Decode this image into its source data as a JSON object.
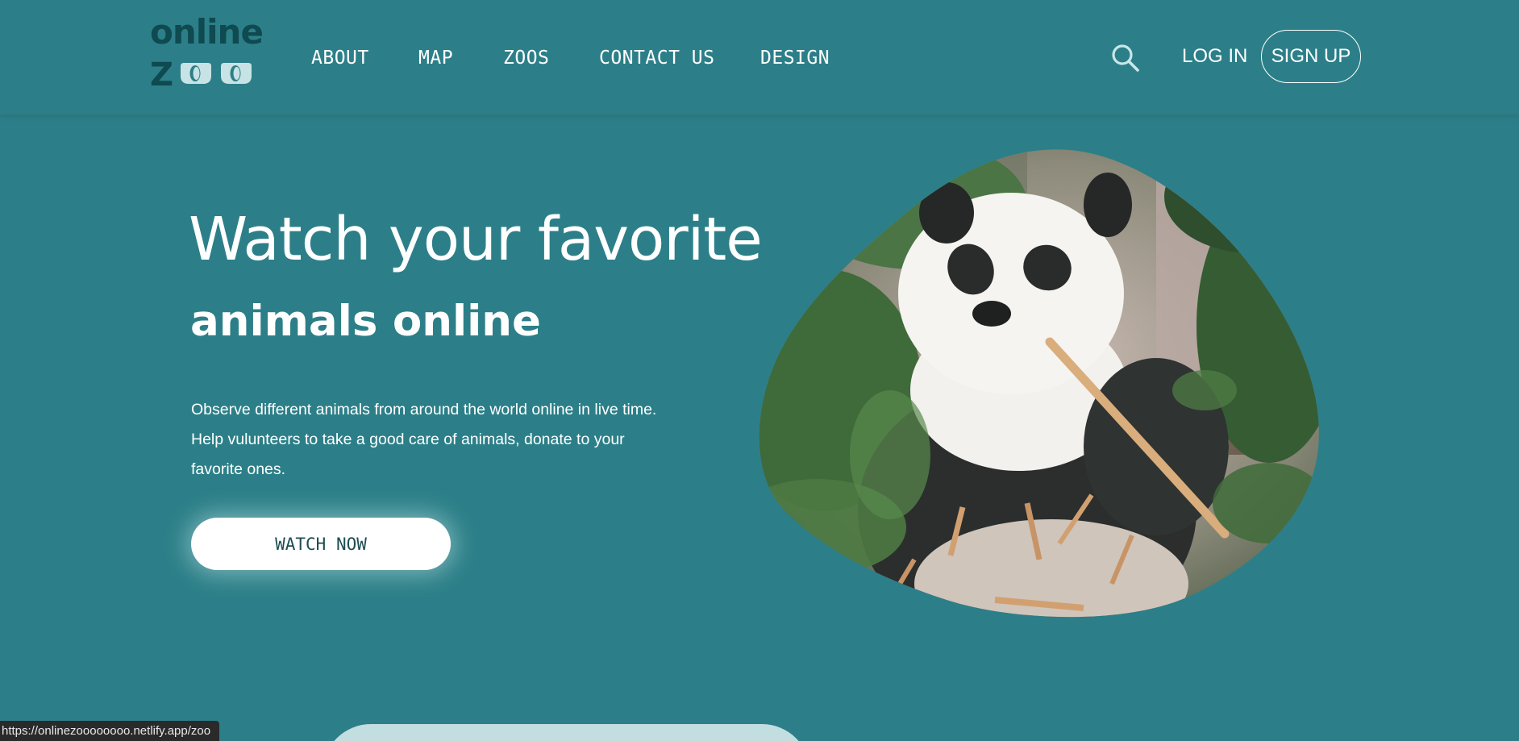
{
  "logo": {
    "line1": "online",
    "line2_letter": "Z",
    "accent_color": "#c7e3e5",
    "ink_color": "#0f4a50"
  },
  "nav": {
    "items": [
      {
        "label": "ABOUT"
      },
      {
        "label": "MAP"
      },
      {
        "label": "ZOOS"
      },
      {
        "label": "CONTACT US"
      },
      {
        "label": "DESIGN"
      }
    ]
  },
  "header_actions": {
    "search_icon": "search-icon",
    "login_label": "LOG IN",
    "signup_label": "SIGN UP"
  },
  "hero": {
    "title_line1": "Watch your favorite",
    "title_line2": "animals online",
    "description_lines": [
      "Observe different animals from around the world online in live time.",
      "Help vulunteers to take a good care of animals, donate to your",
      "favorite ones."
    ],
    "cta_label": "WATCH NOW",
    "image_subject": "panda eating bamboo"
  },
  "status_bar": {
    "url": "https://onlinezoooooooo.netlify.app/zoo"
  },
  "colors": {
    "background": "#2c7f88",
    "button_text": "#1d4d52",
    "card": "#c3dee0"
  }
}
